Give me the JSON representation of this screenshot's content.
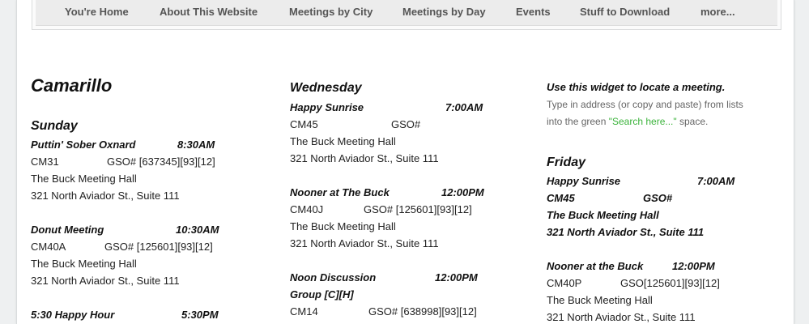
{
  "nav": {
    "items": [
      "You're Home",
      "About This Website",
      "Meetings by City",
      "Meetings by Day",
      "Events",
      "Stuff to Download",
      "more..."
    ]
  },
  "city": "Camarillo",
  "col1": {
    "day": "Sunday",
    "meetings": [
      {
        "name": "Puttin' Sober Oxnard",
        "time": "8:30AM",
        "code": "CM31",
        "gso": "GSO# [637345][93][12]",
        "place": "The Buck Meeting Hall",
        "addr": "321 North Aviador St., Suite 111"
      },
      {
        "name": "Donut Meeting",
        "time": "10:30AM",
        "code": "CM40A",
        "gso": "GSO# [125601][93][12]",
        "place": "The Buck Meeting Hall",
        "addr": "321 North Aviador St., Suite 111"
      },
      {
        "name": "5:30 Happy Hour",
        "time": "5:30PM"
      }
    ]
  },
  "col2": {
    "day": "Wednesday",
    "meetings": [
      {
        "name": "Happy Sunrise",
        "time": "7:00AM",
        "code": "CM45",
        "gso": "GSO#",
        "place": "The Buck Meeting Hall",
        "addr": "321 North Aviador St., Suite  111"
      },
      {
        "name": "Nooner at The Buck",
        "time": "12:00PM",
        "code": "CM40J",
        "gso": "GSO# [125601][93][12]",
        "place": "The Buck Meeting Hall",
        "addr": "321 North Aviador St., Suite 111"
      },
      {
        "name": "Noon Discussion",
        "name2": "Group [C][H]",
        "time": "12:00PM",
        "code": "CM14",
        "gso": "GSO# [638998][93][12]"
      }
    ]
  },
  "col3": {
    "widget_title": "Use this widget to locate a meeting.",
    "widget_line1": "Type in address (or copy and paste) from lists",
    "widget_line2_pre": "into the green ",
    "widget_line2_link": "\"Search here...\"",
    "widget_line2_post": " space.",
    "day": "Friday",
    "meetings": [
      {
        "name": "Happy Sunrise",
        "time": "7:00AM",
        "code": "CM45",
        "gso": "GSO#",
        "place": "The Buck Meeting Hall",
        "addr": "321 North Aviador St., Suite  111"
      },
      {
        "name": "Nooner at the Buck",
        "time": "12:00PM",
        "code": "CM40P",
        "gso": "GSO[125601][93][12]",
        "place": "The Buck Meeting Hall",
        "addr": "321 North Aviador St., Suite 111"
      }
    ]
  },
  "colors": {
    "link_green": "#3bb33b",
    "nav_bg": "#ececec"
  }
}
